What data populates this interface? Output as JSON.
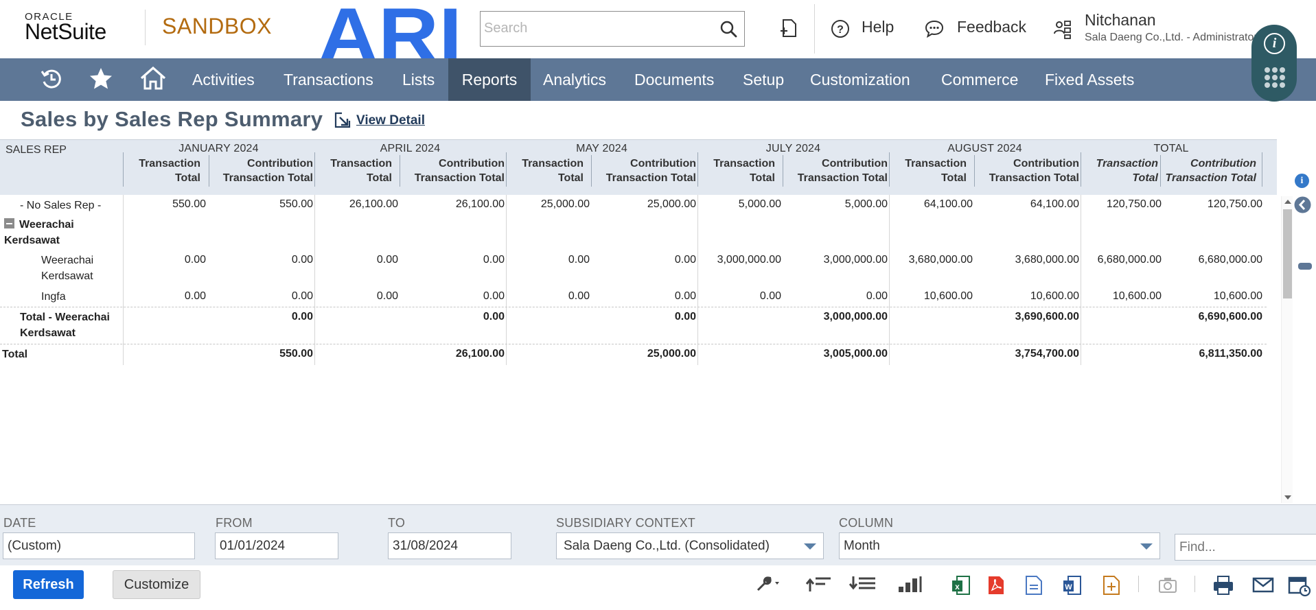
{
  "header": {
    "brand_top": "ORACLE",
    "brand_bottom": "NetSuite",
    "environment": "SANDBOX",
    "company_logo_text": "ARI",
    "search_placeholder": "Search",
    "help": "Help",
    "feedback": "Feedback",
    "user_name": "Nitchanan",
    "user_context": "Sala Daeng Co.,Ltd. - Administrator"
  },
  "nav": {
    "items": [
      {
        "label": "Activities",
        "active": false
      },
      {
        "label": "Transactions",
        "active": false
      },
      {
        "label": "Lists",
        "active": false
      },
      {
        "label": "Reports",
        "active": true
      },
      {
        "label": "Analytics",
        "active": false
      },
      {
        "label": "Documents",
        "active": false
      },
      {
        "label": "Setup",
        "active": false
      },
      {
        "label": "Customization",
        "active": false
      },
      {
        "label": "Commerce",
        "active": false
      },
      {
        "label": "Fixed Assets",
        "active": false
      }
    ]
  },
  "page": {
    "title": "Sales by Sales Rep Summary",
    "view_detail": "View Detail"
  },
  "report": {
    "row_header": "SALES REP",
    "groups": [
      "JANUARY 2024",
      "APRIL 2024",
      "MAY 2024",
      "JULY 2024",
      "AUGUST 2024",
      "TOTAL"
    ],
    "sub_col_1_line1": "Transaction",
    "sub_col_1_line2": "Total",
    "sub_col_2_line1": "Contribution",
    "sub_col_2_line2": "Transaction Total",
    "rows": [
      {
        "label": "- No Sales Rep -",
        "values": [
          "550.00",
          "550.00",
          "26,100.00",
          "26,100.00",
          "25,000.00",
          "25,000.00",
          "5,000.00",
          "5,000.00",
          "64,100.00",
          "64,100.00",
          "120,750.00",
          "120,750.00"
        ]
      },
      {
        "label_line1": "Weerachai",
        "label_line2": "Kerdsawat"
      },
      {
        "label_line1": "Weerachai",
        "label_line2": "Kerdsawat",
        "values": [
          "0.00",
          "0.00",
          "0.00",
          "0.00",
          "0.00",
          "0.00",
          "3,000,000.00",
          "3,000,000.00",
          "3,680,000.00",
          "3,680,000.00",
          "6,680,000.00",
          "6,680,000.00"
        ]
      },
      {
        "label": "Ingfa",
        "values": [
          "0.00",
          "0.00",
          "0.00",
          "0.00",
          "0.00",
          "0.00",
          "0.00",
          "0.00",
          "10,600.00",
          "10,600.00",
          "10,600.00",
          "10,600.00"
        ]
      },
      {
        "label_line1": "Total - Weerachai",
        "label_line2": "Kerdsawat",
        "values": [
          "0.00",
          "0.00",
          "0.00",
          "3,000,000.00",
          "3,690,600.00",
          "6,690,600.00"
        ]
      },
      {
        "label": "Total",
        "values": [
          "550.00",
          "26,100.00",
          "25,000.00",
          "3,005,000.00",
          "3,754,700.00",
          "6,811,350.00"
        ]
      }
    ]
  },
  "filters": {
    "date_label": "DATE",
    "date_value": "(Custom)",
    "from_label": "FROM",
    "from_value": "01/01/2024",
    "to_label": "TO",
    "to_value": "31/08/2024",
    "subsidiary_label": "SUBSIDIARY CONTEXT",
    "subsidiary_value": "Sala Daeng Co.,Ltd. (Consolidated)",
    "column_label": "COLUMN",
    "column_value": "Month",
    "find_placeholder": "Find..."
  },
  "footer": {
    "refresh": "Refresh",
    "customize": "Customize"
  },
  "colors": {
    "nav_bg": "#5e7796",
    "nav_active": "#3f5369",
    "sandbox": "#b36b10",
    "ari_blue": "#2f6fe6",
    "refresh_bg": "#1467d8",
    "header_bg": "#e2e8f0"
  }
}
